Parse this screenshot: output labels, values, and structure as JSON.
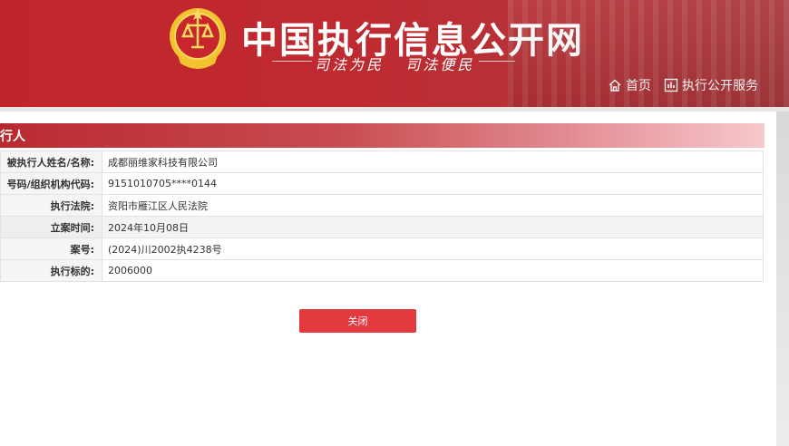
{
  "header": {
    "site_title": "中国执行信息公开网",
    "slogan": "司法为民   司法便民",
    "nav": [
      {
        "label": "首页",
        "icon": "home-icon"
      },
      {
        "label": "执行公开服务",
        "icon": "chart-icon"
      }
    ]
  },
  "panel": {
    "title": "行人",
    "rows": [
      {
        "label": "被执行人姓名/名称:",
        "value": "成都丽维家科技有限公司"
      },
      {
        "label": "号码/组织机构代码:",
        "value": "9151010705****0144"
      },
      {
        "label": "执行法院:",
        "value": "资阳市雁江区人民法院"
      },
      {
        "label": "立案时间:",
        "value": "2024年10月08日"
      },
      {
        "label": "案号:",
        "value": "(2024)川2002执4238号"
      },
      {
        "label": "执行标的:",
        "value": "2006000"
      }
    ]
  },
  "close_button": "关闭",
  "colors": {
    "header_red": "#c0252b",
    "button_red": "#e23a3f",
    "emblem_gold": "#f2c230"
  }
}
